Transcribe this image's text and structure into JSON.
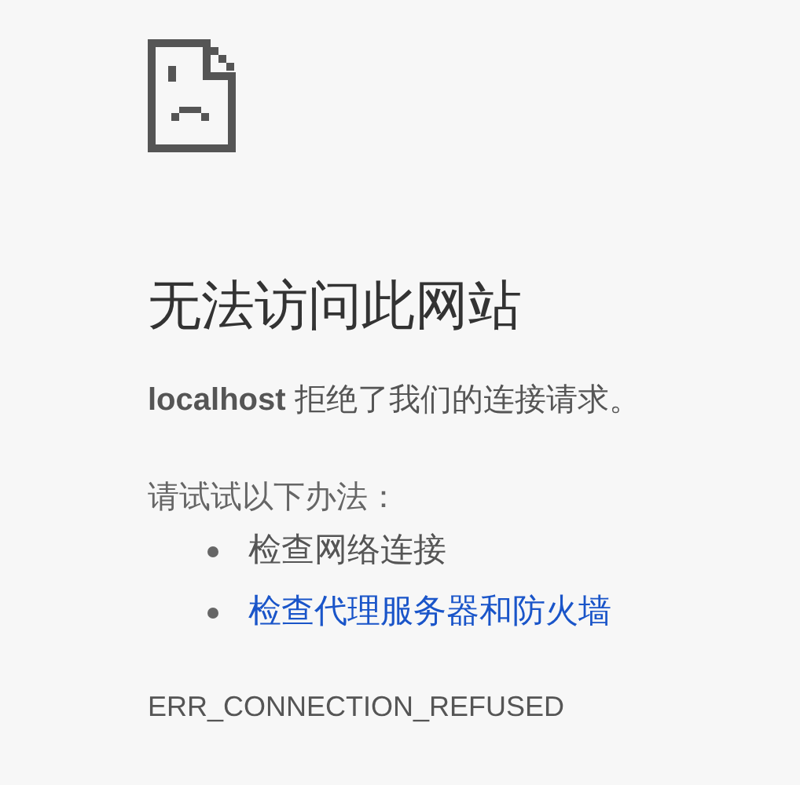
{
  "heading": "无法访问此网站",
  "summary": "**localhost** 拒绝了我们的连接请求。",
  "suggestions_heading": "请试试以下办法：",
  "suggestions": [
    {
      "kind": "text",
      "label": "检查网络连接"
    },
    {
      "kind": "link",
      "label": "检查代理服务器和防火墙"
    }
  ],
  "error_code": "ERR_CONNECTION_REFUSED"
}
